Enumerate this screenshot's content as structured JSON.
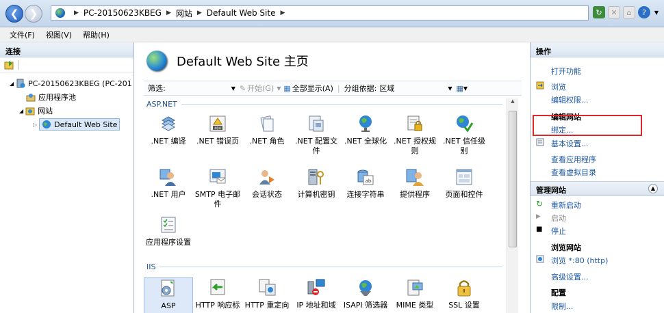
{
  "address": {
    "segments": [
      "PC-20150623KBEG",
      "网站",
      "Default Web Site"
    ]
  },
  "menu": [
    "文件(F)",
    "视图(V)",
    "帮助(H)"
  ],
  "left": {
    "title": "连接",
    "tree": [
      {
        "label": "PC-20150623KBEG (PC-201",
        "level": 0
      },
      {
        "label": "应用程序池",
        "level": 1
      },
      {
        "label": "网站",
        "level": 1
      },
      {
        "label": "Default Web Site",
        "level": 2,
        "selected": true
      }
    ]
  },
  "center": {
    "title": "Default Web Site 主页",
    "filter": {
      "label": "筛选:",
      "go_label": "开始(G)",
      "show_all_label": "全部显示(A)",
      "group_by_label": "分组依据:",
      "group_by_value": "区域"
    },
    "groups": [
      {
        "name": "ASP.NET"
      },
      {
        "name": "IIS"
      }
    ],
    "aspnet_items": [
      ".NET 编译",
      ".NET 错误页",
      ".NET 角色",
      ".NET 配置文件",
      ".NET 全球化",
      ".NET 授权规则",
      ".NET 信任级别",
      ".NET 用户",
      "SMTP 电子邮件",
      "会话状态",
      "计算机密钥",
      "连接字符串",
      "提供程序",
      "页面和控件",
      "应用程序设置"
    ],
    "iis_items": [
      "ASP",
      "HTTP 响应标",
      "HTTP 重定向",
      "IP 地址和域",
      "ISAPI 筛选器",
      "MIME 类型",
      "SSL 设置"
    ]
  },
  "right": {
    "title": "操作",
    "actions_top": {
      "open_feature": "打开功能",
      "browse": "浏览",
      "edit_permissions": "编辑权限...",
      "edit_site": "编辑网站",
      "bindings": "绑定...",
      "basic_settings": "基本设置...",
      "view_apps": "查看应用程序",
      "view_vdirs": "查看虚拟目录"
    },
    "manage": {
      "title": "管理网站",
      "restart": "重新启动",
      "start": "启动",
      "stop": "停止",
      "browse_title": "浏览网站",
      "browse_http": "浏览 *:80 (http)",
      "advanced": "高级设置...",
      "config_title": "配置",
      "limits": "限制..."
    }
  },
  "colors": {
    "link": "#1b57a5",
    "highlight_box": "#e0262a",
    "selection": "#d9e8f9"
  }
}
